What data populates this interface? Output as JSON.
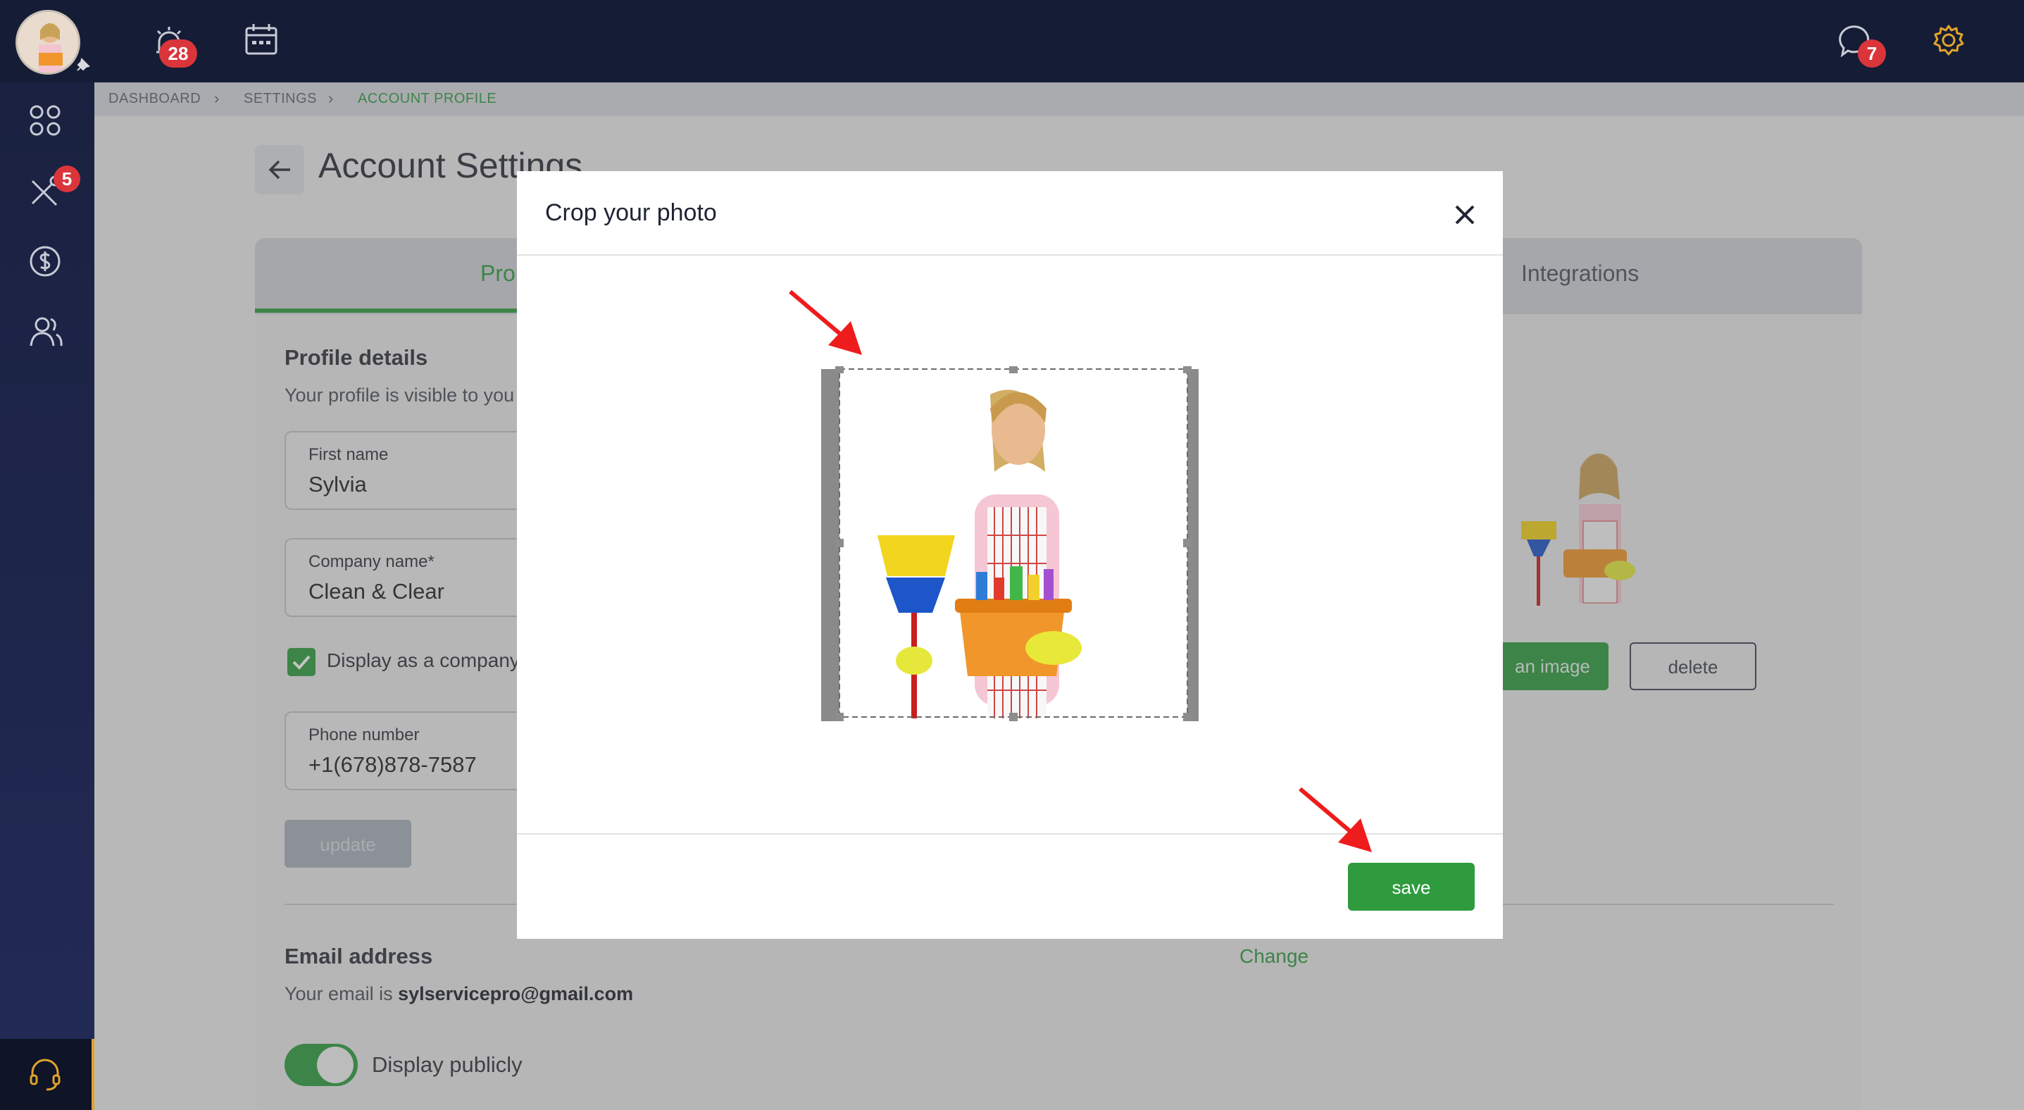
{
  "topbar": {
    "alerts_badge": "28",
    "messages_badge": "7"
  },
  "sidebar": {
    "tools_badge": "5"
  },
  "breadcrumb": {
    "items": [
      "DASHBOARD",
      "SETTINGS",
      "ACCOUNT PROFILE"
    ]
  },
  "page": {
    "title": "Account Settings"
  },
  "tabs": {
    "profile": "Pro",
    "integrations": "Integrations"
  },
  "profile": {
    "heading": "Profile details",
    "subtext": "Your profile is visible to you",
    "first_name_label": "First name",
    "first_name_value": "Sylvia",
    "company_label": "Company name*",
    "company_value": "Clean & Clear",
    "display_company_label": "Display as a company",
    "phone_label": "Phone number",
    "phone_value": "+1(678)878-7587",
    "update_label": "update",
    "upload_label": "an image",
    "delete_label": "delete"
  },
  "email": {
    "heading": "Email address",
    "prefix": "Your email is",
    "address": "sylservicepro@gmail.com",
    "change_label": "Change",
    "display_publicly_label": "Display publicly"
  },
  "modal": {
    "title": "Crop your photo",
    "save_label": "save"
  },
  "colors": {
    "accent_green": "#2e9b3f",
    "topbar": "#151c35",
    "badge_red": "#d9353b",
    "annotation_red": "#ee1c1c"
  }
}
